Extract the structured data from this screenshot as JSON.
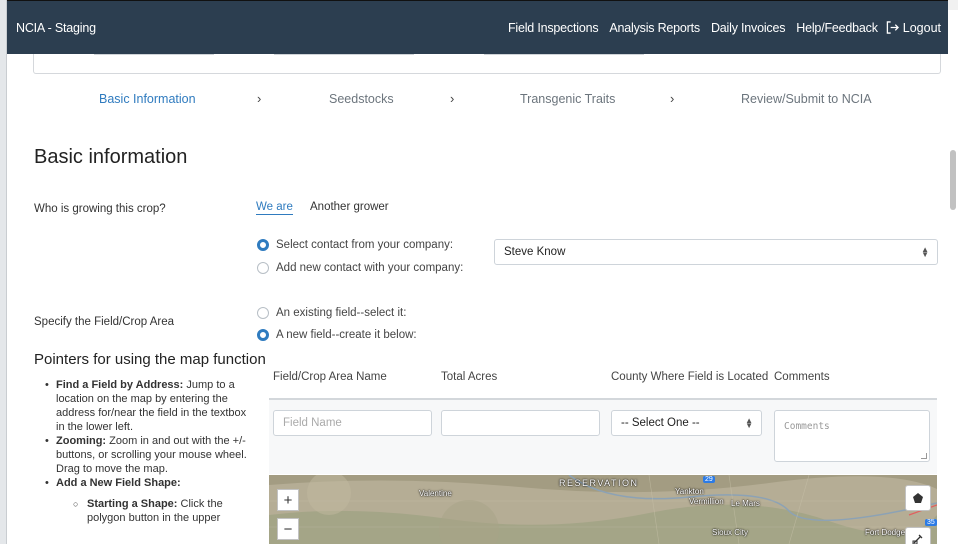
{
  "navbar": {
    "brand": "NCIA - Staging",
    "links": [
      "Field Inspections",
      "Analysis Reports",
      "Daily Invoices",
      "Help/Feedback"
    ],
    "logout": "Logout"
  },
  "steps": [
    {
      "label": "Basic Information",
      "active": true
    },
    {
      "label": "Seedstocks",
      "active": false
    },
    {
      "label": "Transgenic Traits",
      "active": false
    },
    {
      "label": "Review/Submit to NCIA",
      "active": false
    }
  ],
  "step_separator": "›",
  "page_title": "Basic information",
  "grower": {
    "question": "Who is growing this crop?",
    "tabs": [
      {
        "label": "We are",
        "active": true
      },
      {
        "label": "Another grower",
        "active": false
      }
    ],
    "options": [
      {
        "label": "Select contact from your company:",
        "checked": true
      },
      {
        "label": "Add new contact with your company:",
        "checked": false
      }
    ],
    "contact_value": "Steve Know"
  },
  "field": {
    "question": "Specify the Field/Crop Area",
    "options": [
      {
        "label": "An existing field--select it:",
        "checked": false
      },
      {
        "label": "A new field--create it below:",
        "checked": true
      }
    ]
  },
  "pointers": {
    "title": "Pointers for using the map function",
    "items": [
      {
        "bold": "Find a Field by Address:",
        "text": " Jump to a location on the map by entering the address for/near the field in the textbox in the lower left."
      },
      {
        "bold": "Zooming:",
        "text": " Zoom in and out with the +/- buttons, or scrolling your mouse wheel. Drag to move the map."
      },
      {
        "bold": "Add a New Field Shape:",
        "text": ""
      }
    ],
    "sub_items": [
      {
        "bold": "Starting a Shape:",
        "text": " Click the polygon button in the upper"
      }
    ]
  },
  "field_form": {
    "headers": [
      "Field/Crop Area Name",
      "Total Acres",
      "County Where Field is Located",
      "Comments"
    ],
    "name_placeholder": "Field Name",
    "acres_value": "",
    "county_value": "-- Select One --",
    "comments_placeholder": "Comments"
  },
  "map": {
    "zoom_in": "+",
    "zoom_out": "−",
    "labels": [
      "RESERVATION",
      "Valentine",
      "Yankton",
      "Vermillion",
      "Le Mars",
      "Sioux City",
      "Fort Dodge",
      "29",
      "35"
    ]
  },
  "colors": {
    "navbar": "#2c3e50",
    "accent": "#2f7bbf",
    "map_base": "#b5ad95"
  },
  "icons": {
    "logout": "logout-icon",
    "chevron": "chevron-right-icon",
    "select_caret": "sort-caret-icon",
    "polygon": "polygon-draw-icon",
    "edit": "edit-shape-icon"
  }
}
